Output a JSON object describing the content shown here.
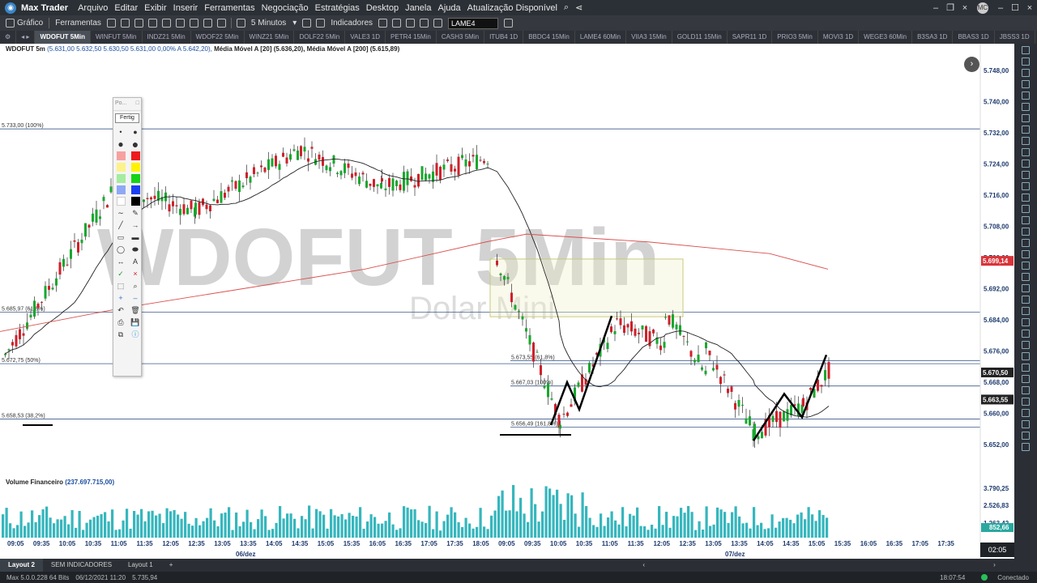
{
  "app": {
    "brand": "Max Trader",
    "menu": [
      "Arquivo",
      "Editar",
      "Exibir",
      "Inserir",
      "Ferramentas",
      "Negociação",
      "Estratégias",
      "Desktop",
      "Janela",
      "Ajuda",
      "Atualização Disponível"
    ],
    "avatar": "MC"
  },
  "toolbar": {
    "grafico": "Gráfico",
    "ferramentas": "Ferramentas",
    "timeframe": "5 Minutos",
    "indicadores": "Indicadores",
    "symbol_input": "LAME4"
  },
  "tabs": [
    "WDOFUT 5Min",
    "WINFUT 5Min",
    "INDZ21 5Min",
    "WDOF22 5Min",
    "WINZ21 5Min",
    "DOLF22 5Min",
    "VALE3 1D",
    "PETR4 15Min",
    "CASH3 5Min",
    "ITUB4 1D",
    "BBDC4 15Min",
    "LAME4 60Min",
    "VIIA3 15Min",
    "GOLD11 15Min",
    "SAPR11 1D",
    "PRIO3 5Min",
    "MOVI3 1D",
    "WEGE3 60Min",
    "B3SA3 1D",
    "BBAS3 1D",
    "JBSS3 1D"
  ],
  "chart": {
    "header_symbol": "WDOFUT 5m",
    "header_ohlc": "(5.631,00  5.632,50  5.630,50  5.631,00  0,00%  A 5.642,20),",
    "header_ma20": "Média Móvel A [20] (5.636,20),",
    "header_ma200": "Média Móvel A [200] (5.615,89)",
    "watermark": "WDOFUT 5Min",
    "watermark_sub": "Dolar Mini",
    "volume_label": "Volume Financeiro",
    "volume_value": "(237.697.715,00)",
    "price_ticks": [
      "5.748,00",
      "5.740,00",
      "5.732,00",
      "5.724,00",
      "5.716,00",
      "5.708,00",
      "5.700,00",
      "5.692,00",
      "5.684,00",
      "5.676,00",
      "5.668,00",
      "5.660,00",
      "5.652,00"
    ],
    "vol_ticks": [
      "3.790,25",
      "2.526,83",
      "1.263,42"
    ],
    "price_badges": [
      {
        "label": "5.699,14",
        "color": "#d9343a",
        "value": 5699.14
      },
      {
        "label": "5.670,50",
        "color": "#222222",
        "value": 5670.5
      },
      {
        "label": "5.663,55",
        "color": "#222222",
        "value": 5663.55
      }
    ],
    "vol_badge": "852,66",
    "time_ticks": [
      "09:05",
      "09:35",
      "10:05",
      "10:35",
      "11:05",
      "11:35",
      "12:05",
      "12:35",
      "13:05",
      "13:35",
      "14:05",
      "14:35",
      "15:05",
      "15:35",
      "16:05",
      "16:35",
      "17:05",
      "17:35",
      "18:05",
      "09:05",
      "09:35",
      "10:05",
      "10:35",
      "11:05",
      "11:35",
      "12:05",
      "12:35",
      "13:05",
      "13:35",
      "14:05",
      "14:35",
      "15:05",
      "15:35",
      "16:05",
      "16:35",
      "17:05",
      "17:35"
    ],
    "date_labels": [
      "06/dez",
      "07/dez"
    ],
    "fib_left": [
      "5.733,00 (100%)",
      "5.685,97 (61,8%)",
      "5.672,75 (50%)",
      "5.658,53 (38,2%)"
    ],
    "fib_right": [
      "5.673,55 (61,8%)",
      "5.667,03 (100%)",
      "5.656,49 (161,8%)"
    ]
  },
  "palette": {
    "title": "Po...",
    "button": "Fertig"
  },
  "layouts": [
    "Layout 2",
    "SEM INDICADORES",
    "Layout 1"
  ],
  "clock": "02:05",
  "status": {
    "version": "Max 5.0.0.228 64 Bits",
    "datetime": "06/12/2021 11:20",
    "price": "5.735,94",
    "time": "18:07:54",
    "connection": "Conectado"
  }
}
